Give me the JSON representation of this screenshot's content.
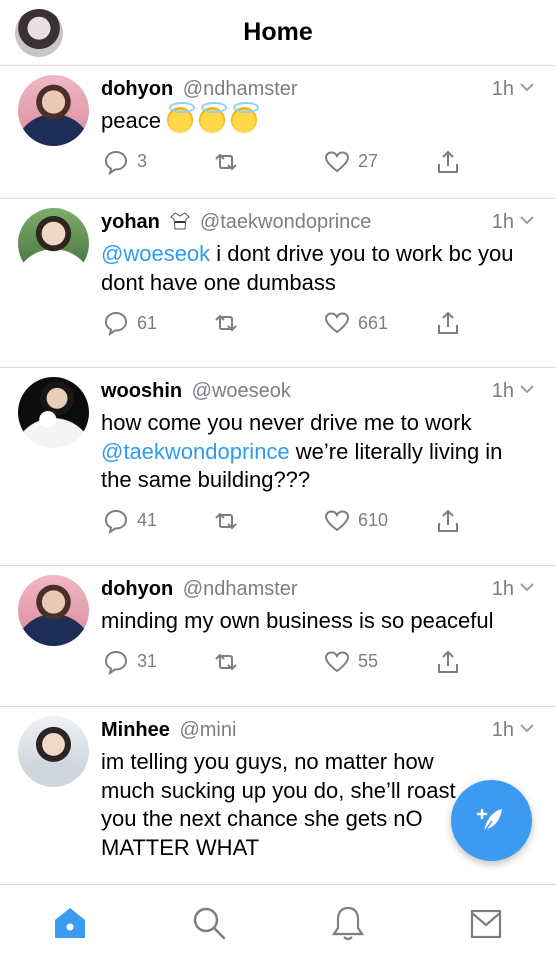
{
  "header": {
    "title": "Home",
    "avatar_icon": "profile-avatar"
  },
  "colors": {
    "accent": "#3c9bf0",
    "mention": "#2f9bef",
    "muted": "#7a7f84"
  },
  "tweets": [
    {
      "name": "dohyon",
      "handle": "@ndhamster",
      "time": "1h",
      "segments": [
        {
          "t": "peace ",
          "m": false
        }
      ],
      "emoji_count": 3,
      "replies": "3",
      "retweets": "",
      "likes": "27"
    },
    {
      "name": "yohan",
      "badge": "taekwondo-uniform",
      "handle": "@taekwondoprince",
      "time": "1h",
      "segments": [
        {
          "t": "@woeseok",
          "m": true
        },
        {
          "t": " i dont drive you to work bc you dont have one dumbass",
          "m": false
        }
      ],
      "replies": "61",
      "retweets": "",
      "likes": "661"
    },
    {
      "name": "wooshin",
      "handle": "@woeseok",
      "time": "1h",
      "segments": [
        {
          "t": "how come you never drive me to work ",
          "m": false
        },
        {
          "t": "@taekwondoprince",
          "m": true
        },
        {
          "t": " we’re literally living in the same building???",
          "m": false
        }
      ],
      "replies": "41",
      "retweets": "",
      "likes": "610"
    },
    {
      "name": "dohyon",
      "handle": "@ndhamster",
      "time": "1h",
      "segments": [
        {
          "t": "minding my own business is so peaceful",
          "m": false
        }
      ],
      "replies": "31",
      "retweets": "",
      "likes": "55"
    },
    {
      "name": "Minhee",
      "handle": "@mini",
      "time": "1h",
      "segments": [
        {
          "t": "im telling you guys, no matter how much sucking up you do, she’ll roast you the next chance she gets nO MATTER WHAT",
          "m": false
        }
      ],
      "replies": "",
      "retweets": "",
      "likes": ""
    }
  ],
  "tabs": [
    {
      "name": "home",
      "icon": "home-icon",
      "active": true
    },
    {
      "name": "search",
      "icon": "search-icon",
      "active": false
    },
    {
      "name": "notifications",
      "icon": "bell-icon",
      "active": false
    },
    {
      "name": "messages",
      "icon": "envelope-icon",
      "active": false
    }
  ],
  "compose_icon": "feather-plus-icon"
}
